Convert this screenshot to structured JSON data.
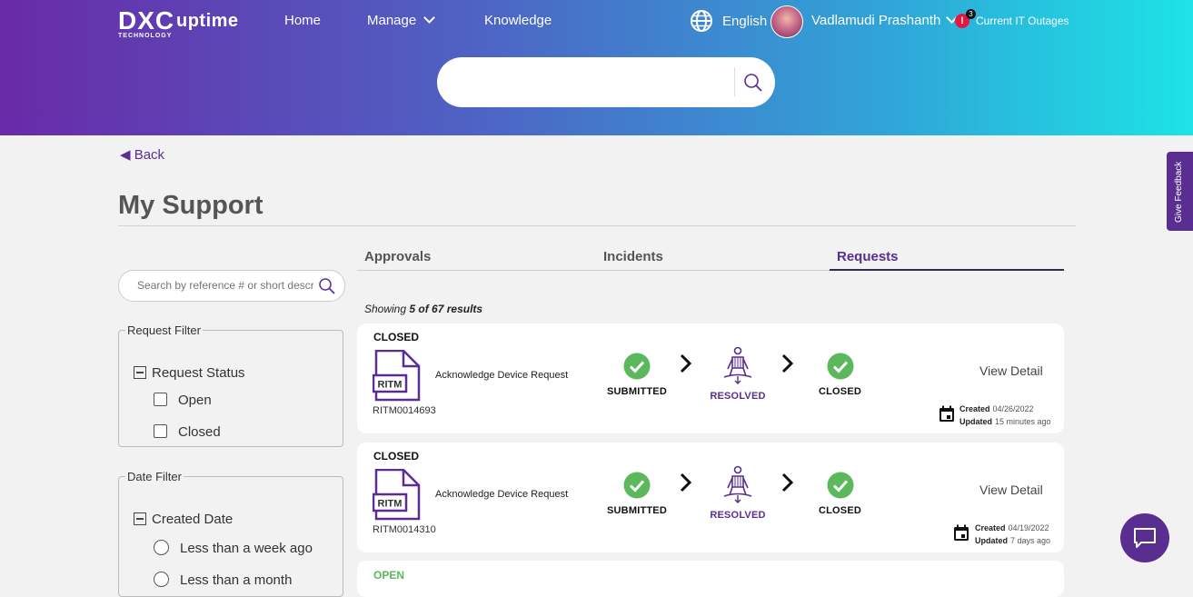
{
  "header": {
    "logo_main": "DXC",
    "logo_sub": "TECHNOLOGY",
    "app_name": "uptime",
    "nav": {
      "home": "Home",
      "manage": "Manage",
      "knowledge": "Knowledge"
    },
    "language": "English",
    "user_name": "Vadlamudi Prashanth",
    "outages_label": "Current IT Outages",
    "outages_count": "3",
    "outages_alert_glyph": "!"
  },
  "search": {
    "value": ""
  },
  "back_label": "Back",
  "page_title": "My Support",
  "tabs": [
    "Approvals",
    "Incidents",
    "Requests"
  ],
  "active_tab": "Requests",
  "side_search": {
    "placeholder": "Search by reference # or short description"
  },
  "filters": {
    "request": {
      "legend": "Request Filter",
      "group": "Request Status",
      "options": [
        "Open",
        "Closed"
      ]
    },
    "date": {
      "legend": "Date Filter",
      "group": "Created Date",
      "options": [
        "Less than a week ago",
        "Less than a month"
      ]
    }
  },
  "results": {
    "prefix": "Showing",
    "count_text": "5 of 67 results"
  },
  "steps": [
    "SUBMITTED",
    "RESOLVED",
    "CLOSED"
  ],
  "labels": {
    "view_detail": "View Detail",
    "created": "Created",
    "updated": "Updated",
    "ritm_icon_text": "RITM"
  },
  "cards": [
    {
      "status": "CLOSED",
      "ref": "RITM0014693",
      "description": "Acknowledge Device Request",
      "created": "04/26/2022",
      "updated": "15 minutes ago"
    },
    {
      "status": "CLOSED",
      "ref": "RITM0014310",
      "description": "Acknowledge Device Request",
      "created": "04/19/2022",
      "updated": "7 days ago"
    },
    {
      "status": "OPEN"
    }
  ],
  "feedback_label": "Give Feedback",
  "colors": {
    "brand_purple": "#5a2d91",
    "success_green": "#5cb85c",
    "alert_red": "#e5173f",
    "header_gradient_start": "#6a2aa8",
    "header_gradient_end": "#1de3e6"
  }
}
